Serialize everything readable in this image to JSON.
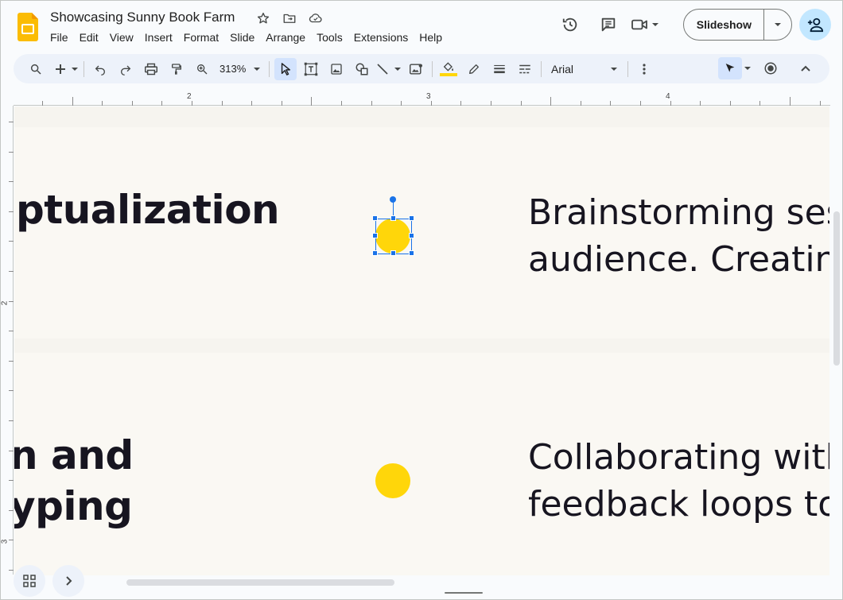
{
  "app": {
    "title": "Showcasing Sunny Book Farm",
    "menus": [
      "File",
      "Edit",
      "View",
      "Insert",
      "Format",
      "Slide",
      "Arrange",
      "Tools",
      "Extensions",
      "Help"
    ]
  },
  "header": {
    "slideshow_label": "Slideshow"
  },
  "toolbar": {
    "zoom": "313%",
    "font": "Arial"
  },
  "ruler": {
    "top_labels": [
      "2",
      "3",
      "4"
    ],
    "left_labels": [
      "2",
      "3"
    ]
  },
  "slide": {
    "heading_1": "ptualization",
    "heading_2_line1": "n and",
    "heading_2_line2": "yping",
    "body_1_line1": "Brainstorming ses",
    "body_1_line2": "audience. Creatin",
    "body_2_line1": "Collaborating with",
    "body_2_line2": "feedback loops to"
  },
  "colors": {
    "accent_dot": "#ffd60a",
    "selection": "#1a73e8",
    "share_bg": "#c2e7ff"
  },
  "icons": {
    "logo": "slides-logo-icon",
    "star": "star-icon",
    "move": "move-to-folder-icon",
    "cloud": "cloud-saved-icon"
  }
}
